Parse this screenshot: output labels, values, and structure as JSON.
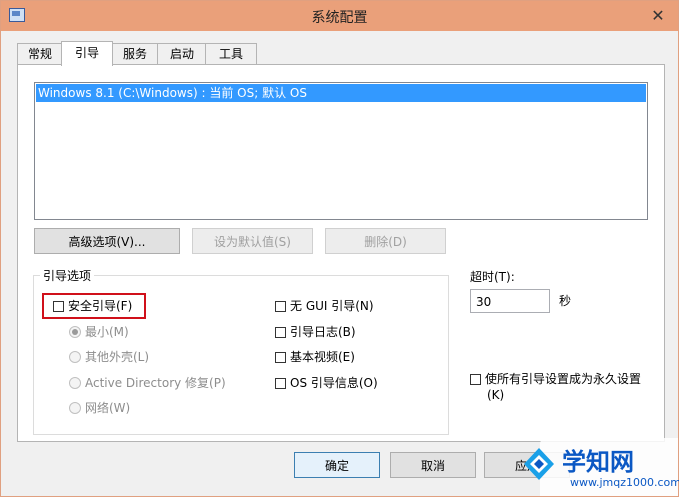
{
  "window": {
    "title": "系统配置",
    "close_glyph": "✕"
  },
  "tabs": [
    {
      "label": "常规"
    },
    {
      "label": "引导"
    },
    {
      "label": "服务"
    },
    {
      "label": "启动"
    },
    {
      "label": "工具"
    }
  ],
  "os_list": {
    "items": [
      {
        "label": "Windows 8.1 (C:\\Windows) : 当前 OS; 默认 OS",
        "selected": true
      }
    ]
  },
  "buttons": {
    "advanced": "高级选项(V)...",
    "set_default": "设为默认值(S)",
    "delete": "删除(D)"
  },
  "boot_options": {
    "group_title": "引导选项",
    "safe_boot": {
      "label": "安全引导(F)",
      "checked": false
    },
    "radios": [
      {
        "label": "最小(M)",
        "checked": true
      },
      {
        "label": "其他外壳(L)",
        "checked": false
      },
      {
        "label": "Active Directory 修复(P)",
        "checked": false
      },
      {
        "label": "网络(W)",
        "checked": false
      }
    ],
    "checks": [
      {
        "label": "无 GUI 引导(N)",
        "checked": false
      },
      {
        "label": "引导日志(B)",
        "checked": false
      },
      {
        "label": "基本视频(E)",
        "checked": false
      },
      {
        "label": "OS 引导信息(O)",
        "checked": false
      }
    ]
  },
  "timeout": {
    "label": "超时(T):",
    "value": "30",
    "unit": "秒"
  },
  "permanent": {
    "label_line1": "使所有引导设置成为永久设置",
    "label_line2": "(K)",
    "checked": false
  },
  "footer": {
    "ok": "确定",
    "cancel": "取消",
    "apply": "应用"
  },
  "watermark": {
    "title": "学知网",
    "url": "www.jmqz1000.com"
  },
  "colors": {
    "titlebar": "#eaa07a",
    "selection": "#3399ff",
    "highlight": "#d0101a"
  }
}
